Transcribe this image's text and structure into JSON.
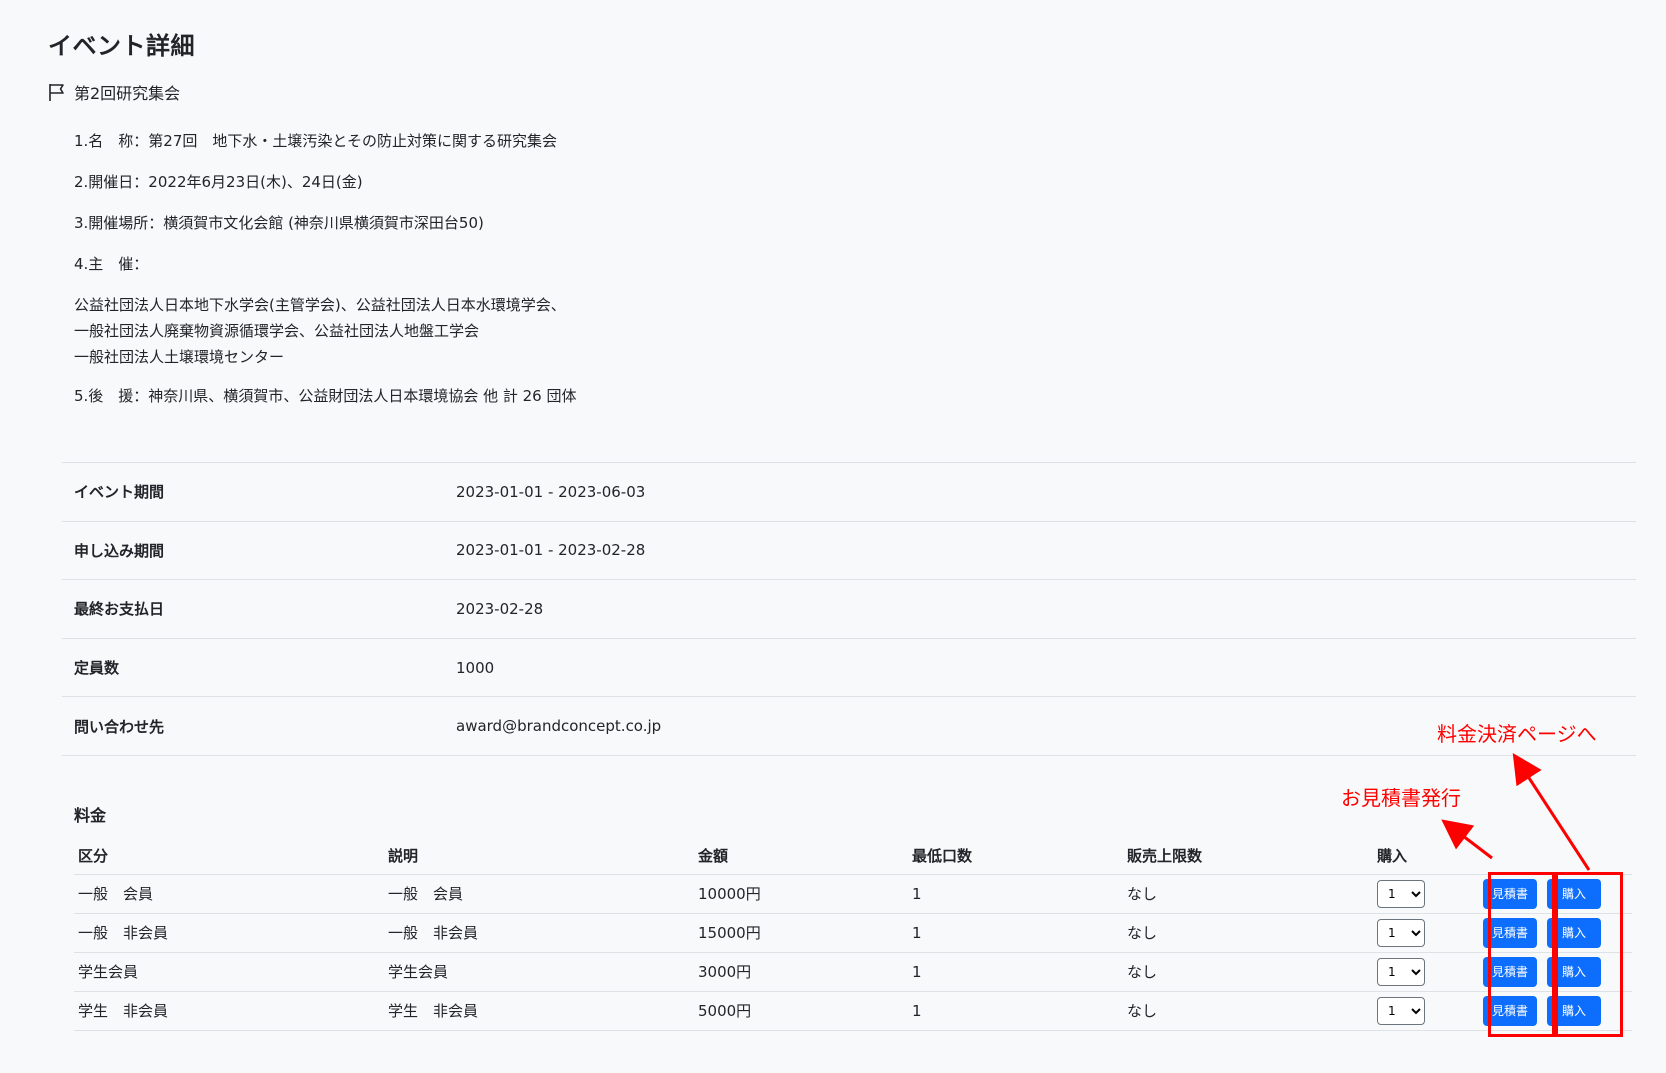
{
  "page_title": "イベント詳細",
  "event_name": "第2回研究集会",
  "description": {
    "line1": "1.名　称：第27回　地下水・土壌汚染とその防止対策に関する研究集会",
    "line2": "2.開催日：2022年6月23日(木)、24日(金)",
    "line3": "3.開催場所：横須賀市文化会館 (神奈川県横須賀市深田台50)",
    "line4": "4.主　催：",
    "organizers": [
      "公益社団法人日本地下水学会(主管学会)、公益社団法人日本水環境学会、",
      "一般社団法人廃棄物資源循環学会、公益社団法人地盤工学会",
      "一般社団法人土壌環境センター"
    ],
    "line5": "5.後　援：神奈川県、横須賀市、公益財団法人日本環境協会 他 計 26 団体"
  },
  "info": [
    {
      "label": "イベント期間",
      "value": "2023-01-01 - 2023-06-03"
    },
    {
      "label": "申し込み期間",
      "value": "2023-01-01 - 2023-02-28"
    },
    {
      "label": "最終お支払日",
      "value": "2023-02-28"
    },
    {
      "label": "定員数",
      "value": "1000"
    },
    {
      "label": "問い合わせ先",
      "value": "award@brandconcept.co.jp"
    }
  ],
  "fee": {
    "title": "料金",
    "headers": [
      "区分",
      "説明",
      "金額",
      "最低口数",
      "販売上限数",
      "購入"
    ],
    "rows": [
      {
        "category": "一般　会員",
        "desc": "一般　会員",
        "price": "10000円",
        "min": "1",
        "limit": "なし",
        "qty": "1"
      },
      {
        "category": "一般　非会員",
        "desc": "一般　非会員",
        "price": "15000円",
        "min": "1",
        "limit": "なし",
        "qty": "1"
      },
      {
        "category": "学生会員",
        "desc": "学生会員",
        "price": "3000円",
        "min": "1",
        "limit": "なし",
        "qty": "1"
      },
      {
        "category": "学生　非会員",
        "desc": "学生　非会員",
        "price": "5000円",
        "min": "1",
        "limit": "なし",
        "qty": "1"
      }
    ],
    "quote_button": "見積書",
    "buy_button": "購入"
  },
  "annotations": {
    "payment": "料金決済ページへ",
    "quote": "お見積書発行"
  },
  "colors": {
    "background": "#f8f9fa",
    "button": "#0d6efd",
    "annotation": "#ff0000"
  },
  "icons": {
    "event": "flag-icon"
  }
}
